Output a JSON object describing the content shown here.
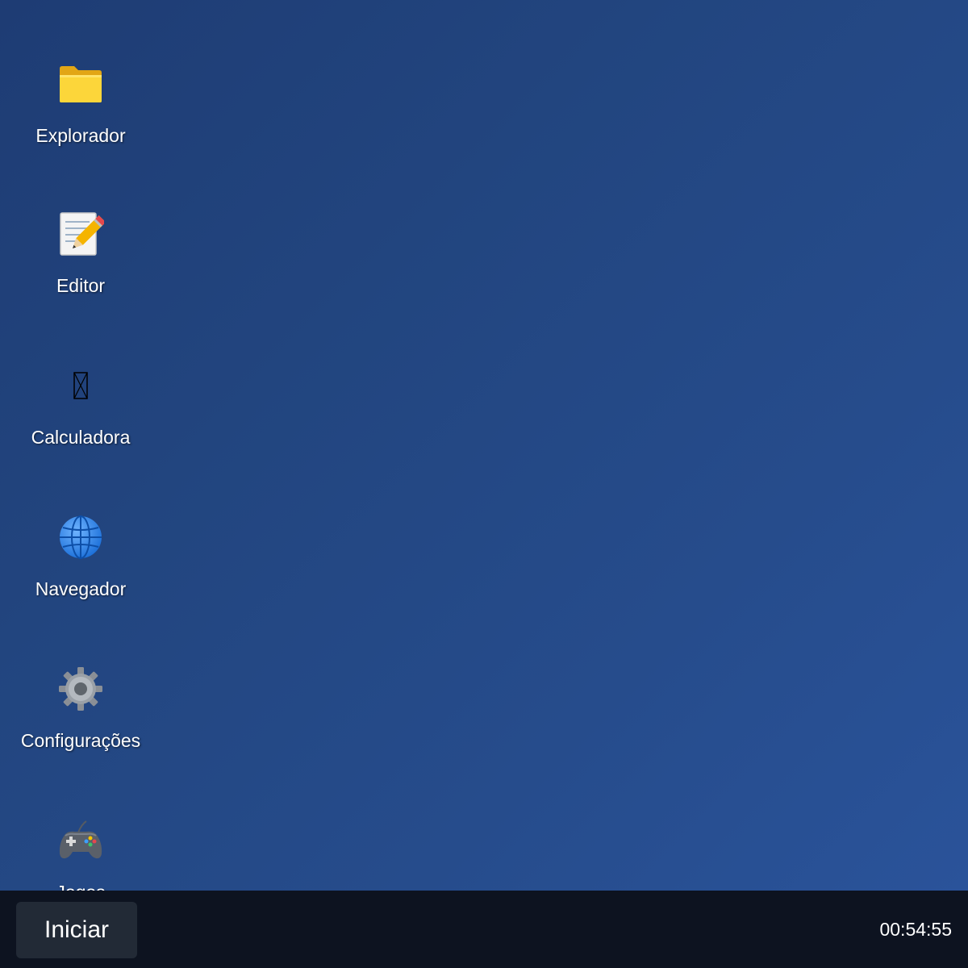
{
  "desktop": {
    "icons": [
      {
        "label": "Explorador",
        "icon": "folder-icon"
      },
      {
        "label": "Editor",
        "icon": "notepad-pencil-icon"
      },
      {
        "label": "Calculadora",
        "icon": "calculator-missing-glyph-icon"
      },
      {
        "label": "Navegador",
        "icon": "globe-icon"
      },
      {
        "label": "Configurações",
        "icon": "gear-icon"
      },
      {
        "label": "Jogos",
        "icon": "gamepad-icon"
      }
    ]
  },
  "taskbar": {
    "start_label": "Iniciar",
    "clock": "00:54:55"
  },
  "colors": {
    "desktop_bg": "#22457f",
    "taskbar_bg": "#0d1320",
    "start_button_bg": "#222a36"
  }
}
